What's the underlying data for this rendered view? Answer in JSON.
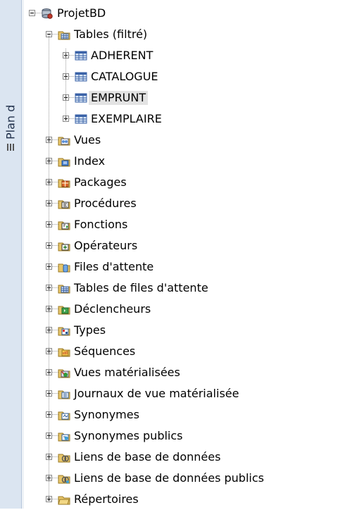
{
  "side_panel": {
    "title": "Plan d"
  },
  "tree": {
    "root": {
      "label": "ProjetBD",
      "icon": "database-connection-icon",
      "expanded": true
    },
    "tables": {
      "label": "Tables (filtré)",
      "icon": "tables-folder-icon",
      "expanded": true,
      "items": [
        {
          "label": "ADHERENT",
          "icon": "table-icon",
          "selected": false
        },
        {
          "label": "CATALOGUE",
          "icon": "table-icon",
          "selected": false
        },
        {
          "label": "EMPRUNT",
          "icon": "table-icon",
          "selected": true
        },
        {
          "label": "EXEMPLAIRE",
          "icon": "table-icon",
          "selected": false
        }
      ]
    },
    "folders": [
      {
        "label": "Vues",
        "icon": "views-icon"
      },
      {
        "label": "Index",
        "icon": "index-icon"
      },
      {
        "label": "Packages",
        "icon": "packages-icon"
      },
      {
        "label": "Procédures",
        "icon": "procedures-icon"
      },
      {
        "label": "Fonctions",
        "icon": "functions-icon"
      },
      {
        "label": "Opérateurs",
        "icon": "operators-icon"
      },
      {
        "label": "Files d'attente",
        "icon": "queues-icon"
      },
      {
        "label": "Tables de files d'attente",
        "icon": "queue-tables-icon"
      },
      {
        "label": "Déclencheurs",
        "icon": "triggers-icon"
      },
      {
        "label": "Types",
        "icon": "types-icon"
      },
      {
        "label": "Séquences",
        "icon": "sequences-icon"
      },
      {
        "label": "Vues matérialisées",
        "icon": "materialized-views-icon"
      },
      {
        "label": "Journaux de vue matérialisée",
        "icon": "materialized-view-logs-icon"
      },
      {
        "label": "Synonymes",
        "icon": "synonyms-icon"
      },
      {
        "label": "Synonymes publics",
        "icon": "public-synonyms-icon"
      },
      {
        "label": "Liens de base de données",
        "icon": "database-links-icon"
      },
      {
        "label": "Liens de base de données publics",
        "icon": "public-database-links-icon"
      },
      {
        "label": "Répertoires",
        "icon": "directories-icon"
      }
    ]
  }
}
